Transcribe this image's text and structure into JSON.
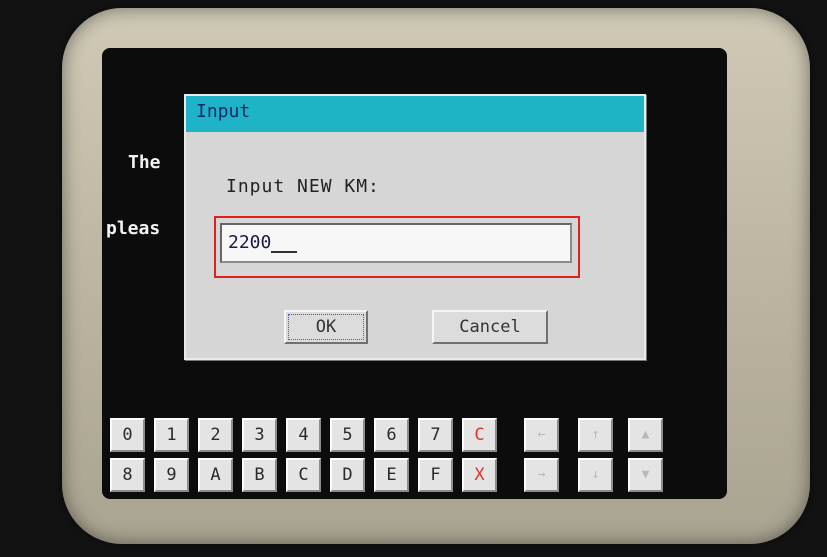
{
  "background_text": [
    "The",
    "pleas"
  ],
  "dialog": {
    "title": "Input",
    "prompt": "Input NEW KM:",
    "input_value": "2200",
    "ok_label": "OK",
    "cancel_label": "Cancel"
  },
  "keypad": {
    "row1": [
      "0",
      "1",
      "2",
      "3",
      "4",
      "5",
      "6",
      "7",
      "C"
    ],
    "row2": [
      "8",
      "9",
      "A",
      "B",
      "C",
      "D",
      "E",
      "F",
      "X"
    ],
    "arrows_row1": [
      "←",
      "↑",
      "▲"
    ],
    "arrows_row2": [
      "→",
      "↓",
      "▼"
    ]
  },
  "colors": {
    "title_bar": "#1fb3c7",
    "highlight_box": "#e0201f",
    "red_keys": "#e0342e"
  }
}
